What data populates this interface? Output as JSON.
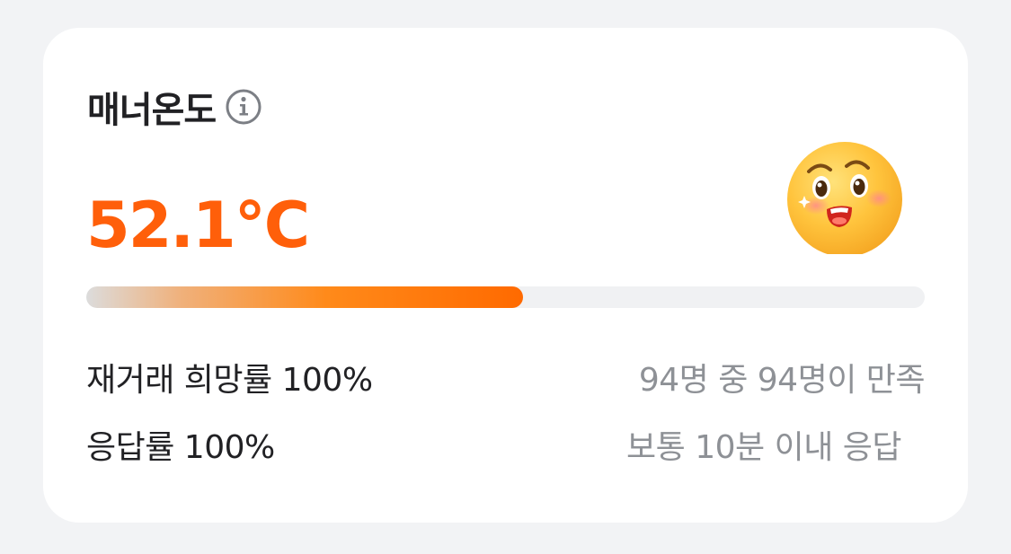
{
  "manner": {
    "title": "매너온도",
    "temperature": "52.1°C",
    "gauge_percent": 52.1,
    "accent_color": "#ff5f0a"
  },
  "icons": {
    "info": "info-circle-icon",
    "face": "smiling-face-emoji"
  },
  "stats": [
    {
      "label": "재거래 희망률 100%",
      "detail": "94명 중 94명이 만족"
    },
    {
      "label": "응답률 100%",
      "detail": "보통 10분 이내 응답"
    }
  ]
}
